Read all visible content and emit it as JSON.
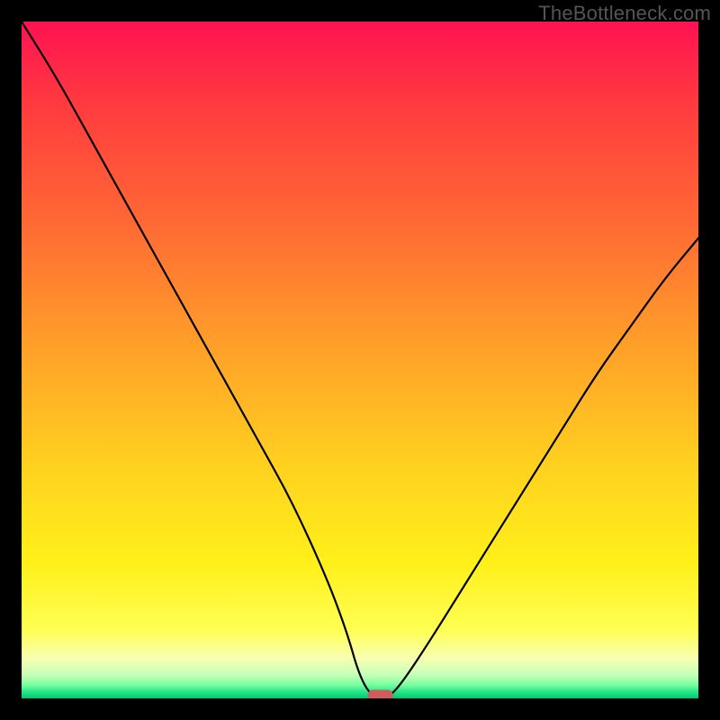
{
  "attribution": "TheBottleneck.com",
  "chart_data": {
    "type": "line",
    "title": "",
    "xlabel": "",
    "ylabel": "",
    "xlim": [
      0,
      100
    ],
    "ylim": [
      0,
      100
    ],
    "background_gradient": {
      "top": "#ff1252",
      "mid_upper": "#ff6a34",
      "mid": "#ffd21f",
      "mid_lower": "#ffff55",
      "bottom": "#00c86f"
    },
    "series": [
      {
        "name": "bottleneck-curve",
        "x": [
          0,
          5,
          10,
          15,
          20,
          25,
          30,
          35,
          40,
          45,
          48,
          50,
          52,
          54,
          56,
          60,
          65,
          70,
          75,
          80,
          85,
          90,
          95,
          100
        ],
        "y": [
          100,
          92,
          83,
          74,
          65,
          56,
          47,
          38,
          29,
          18,
          10,
          3,
          0,
          0,
          2,
          8,
          16,
          24,
          32,
          40,
          48,
          55,
          62,
          68
        ]
      }
    ],
    "marker": {
      "name": "optimal-point",
      "x": 53,
      "y": 0,
      "color": "#cf5d5d",
      "shape": "pill"
    }
  }
}
